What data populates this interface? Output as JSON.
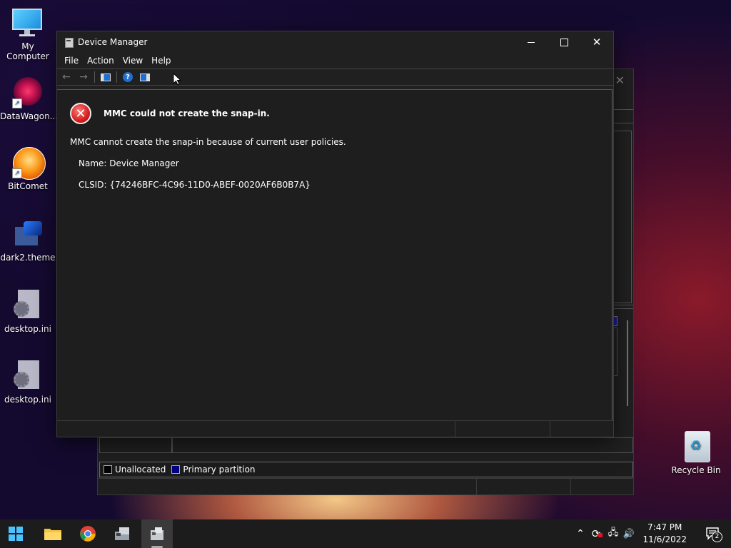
{
  "desktop": {
    "icons": [
      {
        "label": "My Computer"
      },
      {
        "label": "DataWagon..."
      },
      {
        "label": "BitComet"
      },
      {
        "label": "dark2.theme"
      },
      {
        "label": "desktop.ini"
      },
      {
        "label": "desktop.ini"
      },
      {
        "label": "Recycle Bin"
      }
    ]
  },
  "back_window": {
    "legend": {
      "unallocated": "Unallocated",
      "primary": "Primary partition"
    },
    "colors": {
      "unallocated": "#000000",
      "primary": "#000080"
    }
  },
  "window": {
    "title": "Device Manager",
    "menu": [
      "File",
      "Action",
      "View",
      "Help"
    ],
    "error": {
      "title": "MMC could not create the snap-in.",
      "body": "MMC cannot create the snap-in because of current user policies.",
      "name_line": "Name: Device Manager",
      "clsid_line": "CLSID: {74246BFC-4C96-11D0-ABEF-0020AF6B0B7A}"
    }
  },
  "taskbar": {
    "clock": {
      "time": "7:47 PM",
      "date": "11/6/2022"
    },
    "notifications_count": "2",
    "apps": [
      "start",
      "file-explorer",
      "chrome",
      "mmc",
      "device-manager"
    ]
  }
}
